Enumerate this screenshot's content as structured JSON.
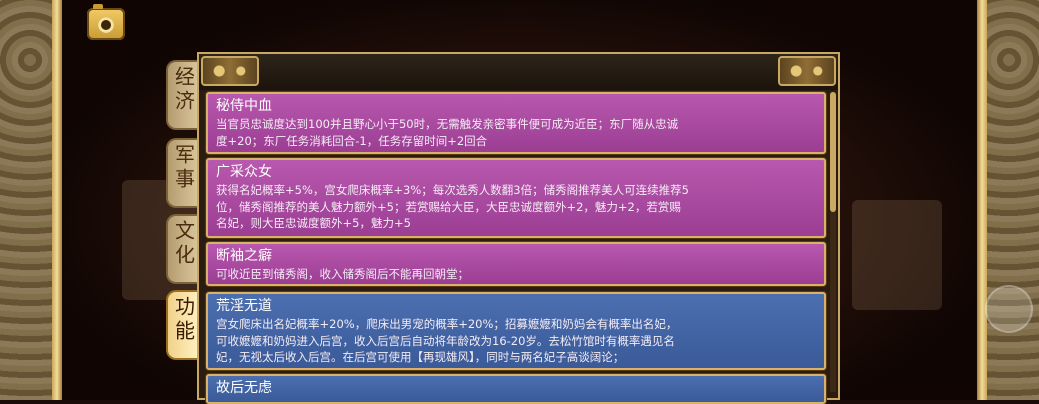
{
  "tabs": [
    {
      "label": "经济",
      "active": false
    },
    {
      "label": "军事",
      "active": false
    },
    {
      "label": "文化",
      "active": false
    },
    {
      "label": "功能",
      "active": true
    }
  ],
  "cards": [
    {
      "title": "秘侍中血",
      "description": "当官员忠诚度达到100并且野心小于50时，无需触发亲密事件便可成为近臣；东厂随从忠诚\n度+20；东厂任务消耗回合-1，任务存留时间+2回合",
      "color": "purple"
    },
    {
      "title": "广采众女",
      "description": "获得名妃概率+5%，宫女爬床概率+3%；每次选秀人数翻3倍；储秀阁推荐美人可连续推荐5\n位，储秀阁推荐的美人魅力额外+5；若赏赐给大臣，大臣忠诚度额外+2，魅力+2，若赏赐\n名妃，则大臣忠诚度额外+5，魅力+5",
      "color": "purple"
    },
    {
      "title": "断袖之癖",
      "description": "可收近臣到储秀阁，收入储秀阁后不能再回朝堂；",
      "color": "purple"
    },
    {
      "title": "荒淫无道",
      "description": "宫女爬床出名妃概率+20%，爬床出男宠的概率+20%；招募嬷嬷和奶妈会有概率出名妃，\n可收嬷嬷和奶妈进入后宫，收入后宫后自动将年龄改为16-20岁。去松竹馆时有概率遇见名\n妃，无视太后收入后宫。在后宫可使用【再现雄风】，同时与两名妃子高谈阔论；",
      "color": "blue"
    },
    {
      "title": "故后无虑",
      "description": "",
      "color": "blue"
    }
  ]
}
